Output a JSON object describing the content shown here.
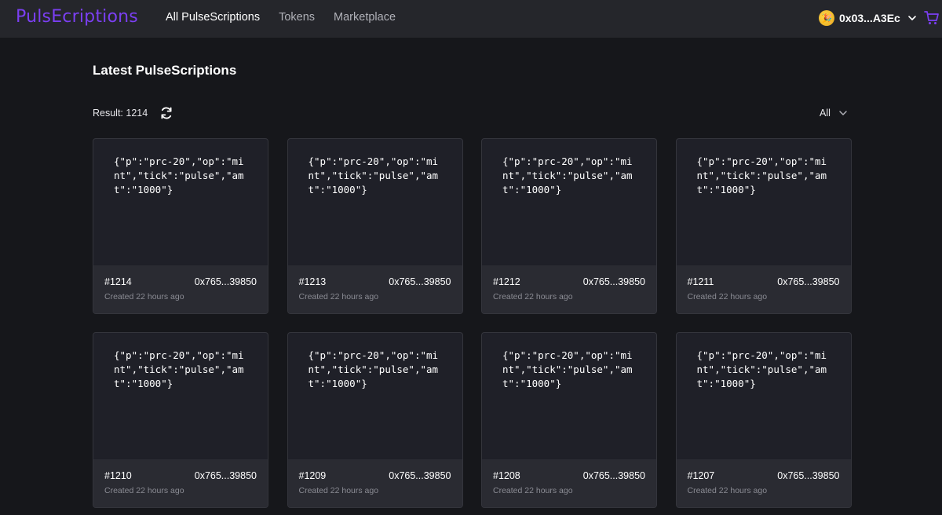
{
  "app": {
    "logo": "PulsEcriptions"
  },
  "nav": [
    {
      "label": "All PulseScriptions",
      "active": true
    },
    {
      "label": "Tokens",
      "active": false
    },
    {
      "label": "Marketplace",
      "active": false
    }
  ],
  "wallet": {
    "address": "0x03...A3Ec",
    "avatar_glyph": "🎉"
  },
  "header": {
    "title": "Latest PulseScriptions",
    "result": "Result: 1214"
  },
  "filter": {
    "selected": "All"
  },
  "colors": {
    "brand": "#7b3ff2",
    "background": "#16171b",
    "card": "#1f2028",
    "card_footer": "#2a2b32"
  },
  "cards": [
    {
      "content": "{\"p\":\"prc-20\",\"op\":\"mint\",\"tick\":\"pulse\",\"amt\":\"1000\"}",
      "number": "#1214",
      "address": "0x765...39850",
      "created": "Created 22 hours ago"
    },
    {
      "content": "{\"p\":\"prc-20\",\"op\":\"mint\",\"tick\":\"pulse\",\"amt\":\"1000\"}",
      "number": "#1213",
      "address": "0x765...39850",
      "created": "Created 22 hours ago"
    },
    {
      "content": "{\"p\":\"prc-20\",\"op\":\"mint\",\"tick\":\"pulse\",\"amt\":\"1000\"}",
      "number": "#1212",
      "address": "0x765...39850",
      "created": "Created 22 hours ago"
    },
    {
      "content": "{\"p\":\"prc-20\",\"op\":\"mint\",\"tick\":\"pulse\",\"amt\":\"1000\"}",
      "number": "#1211",
      "address": "0x765...39850",
      "created": "Created 22 hours ago"
    },
    {
      "content": "{\"p\":\"prc-20\",\"op\":\"mint\",\"tick\":\"pulse\",\"amt\":\"1000\"}",
      "number": "#1210",
      "address": "0x765...39850",
      "created": "Created 22 hours ago"
    },
    {
      "content": "{\"p\":\"prc-20\",\"op\":\"mint\",\"tick\":\"pulse\",\"amt\":\"1000\"}",
      "number": "#1209",
      "address": "0x765...39850",
      "created": "Created 22 hours ago"
    },
    {
      "content": "{\"p\":\"prc-20\",\"op\":\"mint\",\"tick\":\"pulse\",\"amt\":\"1000\"}",
      "number": "#1208",
      "address": "0x765...39850",
      "created": "Created 22 hours ago"
    },
    {
      "content": "{\"p\":\"prc-20\",\"op\":\"mint\",\"tick\":\"pulse\",\"amt\":\"1000\"}",
      "number": "#1207",
      "address": "0x765...39850",
      "created": "Created 22 hours ago"
    }
  ]
}
